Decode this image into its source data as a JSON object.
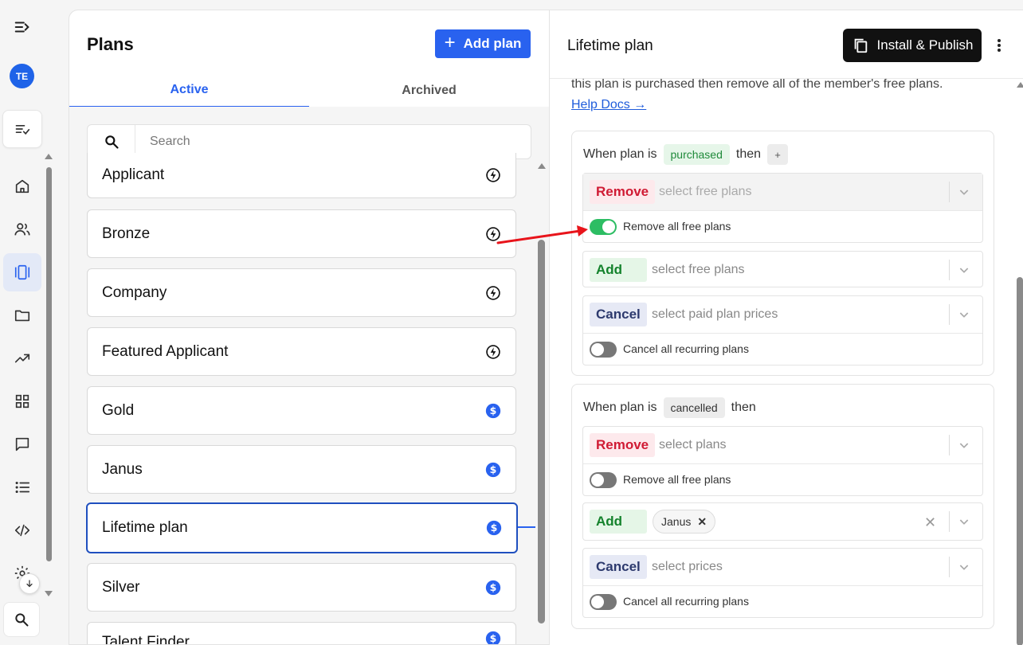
{
  "rail": {
    "avatar_initials": "TE",
    "icons": [
      "expand-menu-icon",
      "checklist-icon",
      "home-icon",
      "users-icon",
      "plans-icon",
      "folder-icon",
      "trending-icon",
      "apps-grid-icon",
      "chat-icon",
      "list-icon",
      "code-icon",
      "settings-icon",
      "arrow-down-icon",
      "search-icon"
    ]
  },
  "plans_panel": {
    "title": "Plans",
    "add_button_label": "Add plan",
    "tabs": [
      {
        "label": "Active",
        "active": true
      },
      {
        "label": "Archived",
        "active": false
      }
    ],
    "search": {
      "placeholder": "Search",
      "value": ""
    },
    "items": [
      {
        "name": "Applicant",
        "icon": "bolt-icon"
      },
      {
        "name": "Bronze",
        "icon": "bolt-icon"
      },
      {
        "name": "Company",
        "icon": "bolt-icon"
      },
      {
        "name": "Featured Applicant",
        "icon": "bolt-icon"
      },
      {
        "name": "Gold",
        "icon": "dollar-icon"
      },
      {
        "name": "Janus",
        "icon": "dollar-icon"
      },
      {
        "name": "Lifetime plan",
        "icon": "dollar-icon",
        "selected": true
      },
      {
        "name": "Silver",
        "icon": "dollar-icon"
      },
      {
        "name": "Talent Finder",
        "icon": "dollar-icon"
      }
    ]
  },
  "detail": {
    "title": "Lifetime plan",
    "publish_label": "Install & Publish",
    "intro_text": "this plan is purchased then remove all of the member's free plans.",
    "help_link": "Help Docs →",
    "rule1": {
      "when": "When plan is",
      "event": "purchased",
      "then": "then",
      "plus": "+",
      "remove": {
        "tag": "Remove",
        "placeholder": "select free plans",
        "toggle_label": "Remove all free plans",
        "toggle_on": true
      },
      "add": {
        "tag": "Add",
        "placeholder": "select free plans"
      },
      "cancel": {
        "tag": "Cancel",
        "placeholder": "select paid plan prices",
        "toggle_label": "Cancel all recurring plans",
        "toggle_on": false
      }
    },
    "rule2": {
      "when": "When plan is",
      "event": "cancelled",
      "then": "then",
      "remove": {
        "tag": "Remove",
        "placeholder": "select plans",
        "toggle_label": "Remove all free plans",
        "toggle_on": false
      },
      "add": {
        "tag": "Add",
        "selected_value": "Janus"
      },
      "cancel": {
        "tag": "Cancel",
        "placeholder": "select prices",
        "toggle_label": "Cancel all recurring plans",
        "toggle_on": false
      }
    }
  },
  "colors": {
    "accent": "#2962ef",
    "remove": "#d01b34",
    "add": "#14822c",
    "toggle_on": "#2dbd63",
    "annotation_arrow": "#e8141b"
  }
}
